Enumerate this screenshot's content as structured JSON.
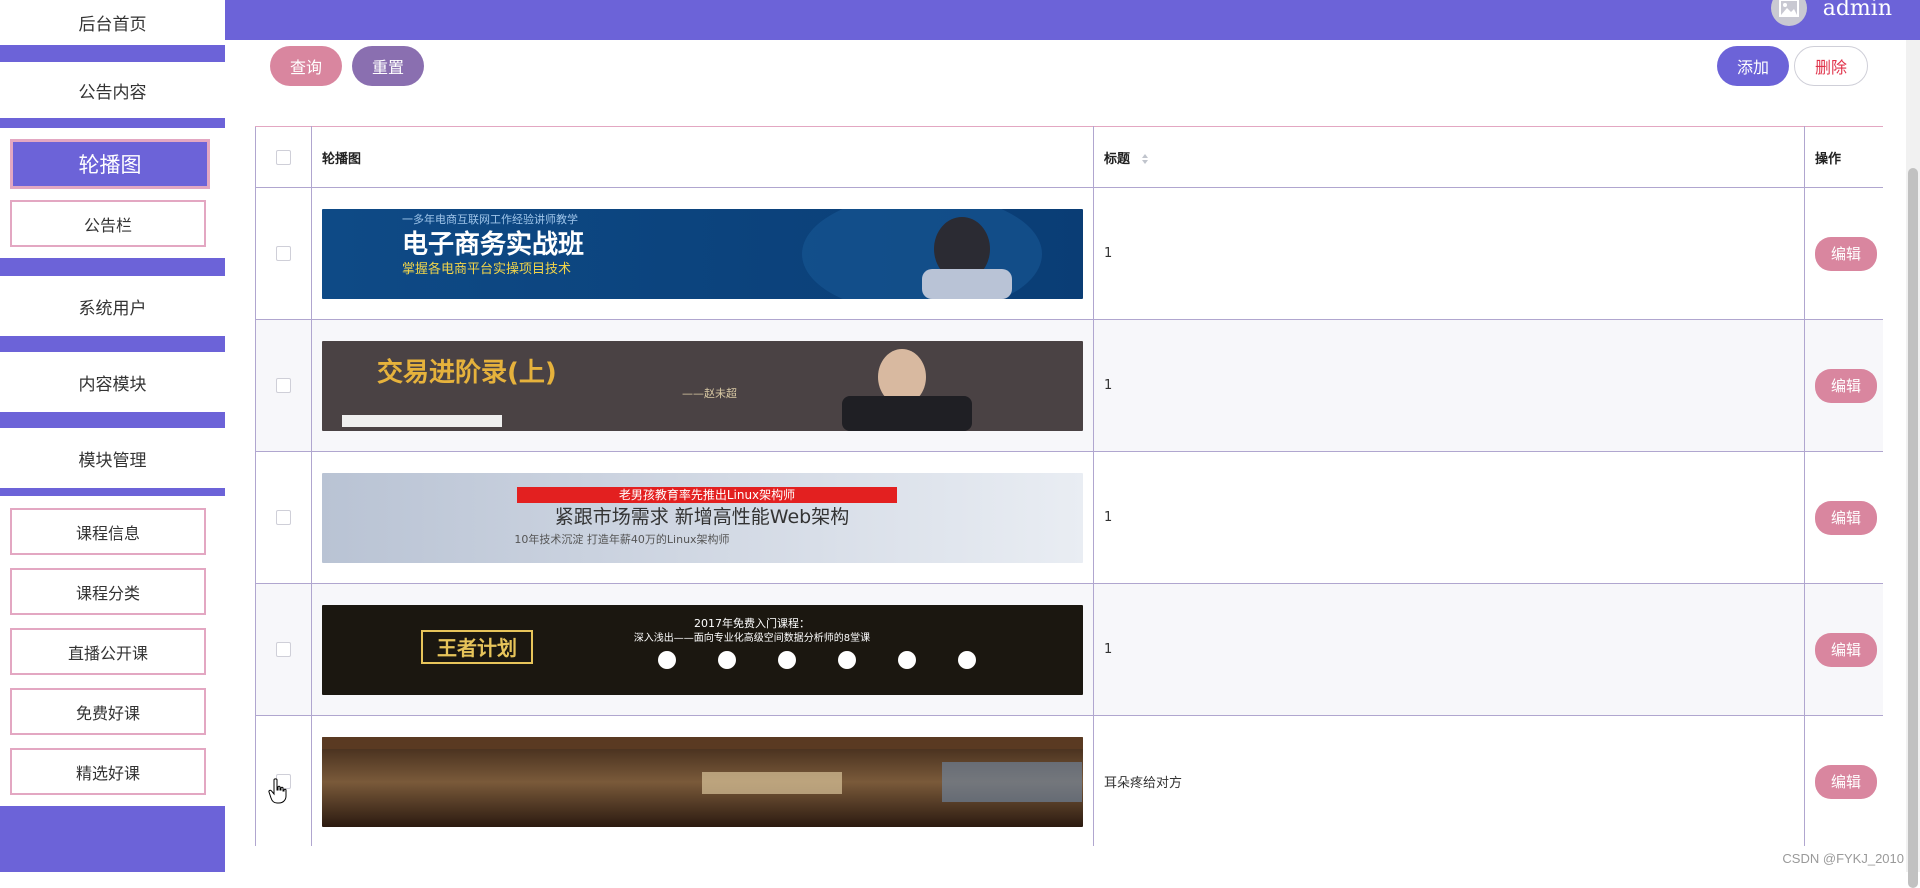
{
  "header": {
    "username": "admin"
  },
  "sidebar": {
    "home": "后台首页",
    "notice_content": "公告内容",
    "carousel": "轮播图",
    "notice_bar": "公告栏",
    "system_users": "系统用户",
    "content_module": "内容模块",
    "module_manage": "模块管理",
    "course_info": "课程信息",
    "course_category": "课程分类",
    "live_course": "直播公开课",
    "free_course": "免费好课",
    "selected_course": "精选好课"
  },
  "toolbar": {
    "query": "查询",
    "reset": "重置",
    "add": "添加",
    "delete": "删除"
  },
  "table": {
    "headers": {
      "image": "轮播图",
      "title": "标题",
      "actions": "操作"
    },
    "edit_label": "编辑",
    "rows": [
      {
        "title": "1",
        "banner_text": "电子商务实战班",
        "banner_sub": "掌握各电商平台实操项目技术",
        "banner_top": "一多年电商互联网工作经验讲师教学"
      },
      {
        "title": "1",
        "banner_text": "交易进阶录(上)",
        "banner_sub": "——赵未超",
        "banner_top": ""
      },
      {
        "title": "1",
        "banner_text": "紧跟市场需求 新增高性能Web架构",
        "banner_sub": "10年技术沉淀  打造年薪40万的Linux架构师",
        "banner_top": "老男孩教育率先推出Linux架构师"
      },
      {
        "title": "1",
        "banner_text": "王者计划",
        "banner_sub": "深入浅出——面向专业化高级空间数据分析师的8堂课",
        "banner_top": "2017年免费入门课程："
      },
      {
        "title": "耳朵疼给对方",
        "banner_text": "",
        "banner_sub": "",
        "banner_top": ""
      }
    ]
  },
  "watermark": "CSDN @FYKJ_2010",
  "colors": {
    "primary": "#6c63d8",
    "pink": "#d9869f",
    "reset": "#8a6fb0"
  }
}
